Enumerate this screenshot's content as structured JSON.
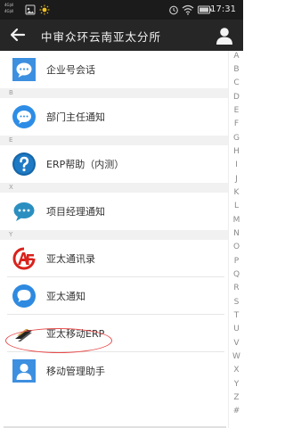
{
  "status_bar": {
    "time": "17:31",
    "carrier_1": "4G|ıll",
    "carrier_2": "4G|ıll",
    "wifi_icon": "wifi-icon",
    "battery_icon": "battery-icon"
  },
  "header": {
    "title": "中审众环云南亚太分所",
    "back_icon": "back-arrow-icon",
    "profile_icon": "person-icon"
  },
  "sections": {
    "b": "B",
    "e": "E",
    "x": "X",
    "y": "Y"
  },
  "items": [
    {
      "label": "企业号会话",
      "icon": "chat-bubble-icon",
      "color": "#3d8fe0"
    },
    {
      "label": "部门主任通知",
      "icon": "chat-bubble-icon",
      "color": "#2d8de6"
    },
    {
      "label": "ERP帮助（内测）",
      "icon": "question-mark-icon",
      "color": "#1565a8"
    },
    {
      "label": "项目经理通知",
      "icon": "chat-bubble-icon",
      "color": "#2a8fc0"
    },
    {
      "label": "亚太通讯录",
      "icon": "af-logo-icon",
      "color": "#d9221c"
    },
    {
      "label": "亚太通知",
      "icon": "speech-bubble-icon",
      "color": "#2e8ae0"
    },
    {
      "label": "亚太移动ERP",
      "icon": "erp-logo-icon",
      "color": "#222222"
    },
    {
      "label": "移动管理助手",
      "icon": "person-icon",
      "color": "#3d8fe0"
    }
  ],
  "index_letters": [
    "A",
    "B",
    "C",
    "D",
    "E",
    "F",
    "G",
    "H",
    "I",
    "J",
    "K",
    "L",
    "M",
    "N",
    "O",
    "P",
    "Q",
    "R",
    "S",
    "T",
    "U",
    "V",
    "W",
    "X",
    "Y",
    "Z",
    "#"
  ]
}
